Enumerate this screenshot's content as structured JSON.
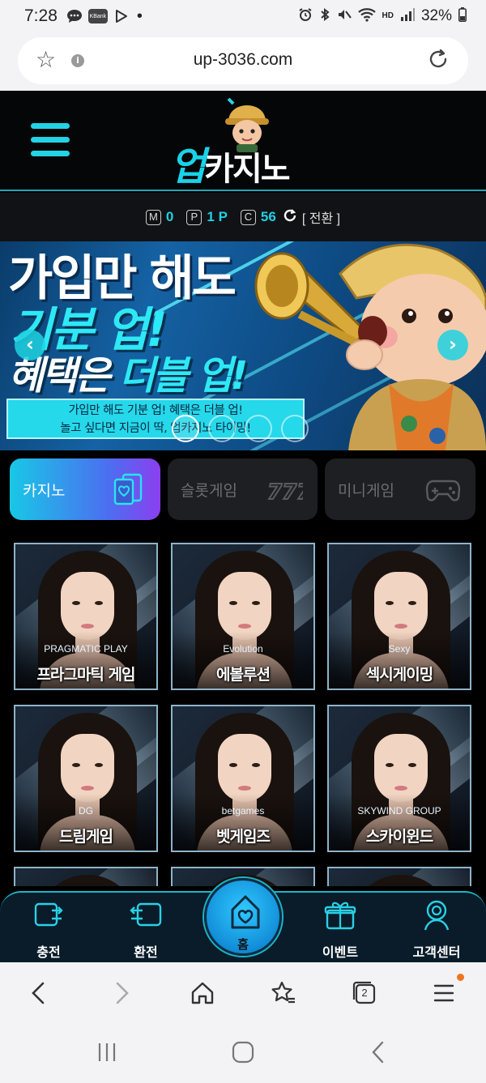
{
  "status_bar": {
    "time": "7:28",
    "ksbank_label": "KBank",
    "battery_percent": "32%",
    "hd_label": "HD"
  },
  "browser": {
    "url": "up-3036.com"
  },
  "site": {
    "logo_up": "업",
    "logo_rest": "카지노"
  },
  "points": {
    "m_badge": "M",
    "m_value": "0",
    "p_badge": "P",
    "p_value": "1 P",
    "c_badge": "C",
    "c_value": "56",
    "switch_label": "[ 전환 ]"
  },
  "banner": {
    "line1": "가입만 해도",
    "line2": "기분 업!",
    "line3_prefix": "혜택은 ",
    "line3_highlight": "더블 업!",
    "box_line1": "가입만 해도 기분 업! 혜택은 더블 업!",
    "box_line2": "놀고 싶다면 지금이 딱, 업카지노 타이밍!",
    "slide_count": 4,
    "active_slide": 1
  },
  "categories": [
    {
      "label": "카지노",
      "active": true,
      "icon": "cards-icon"
    },
    {
      "label": "슬롯게임",
      "active": false,
      "icon": "slot-777-icon"
    },
    {
      "label": "미니게임",
      "active": false,
      "icon": "gamepad-icon"
    }
  ],
  "games": [
    {
      "title": "프라그마틱 게임",
      "brand": "PRAGMATIC PLAY"
    },
    {
      "title": "에볼루션",
      "brand": "Evolution"
    },
    {
      "title": "섹시게이밍",
      "brand": "Sexy"
    },
    {
      "title": "드림게임",
      "brand": "DG"
    },
    {
      "title": "벳게임즈",
      "brand": "betgames"
    },
    {
      "title": "스카이윈드",
      "brand": "SKYWIND GROUP"
    }
  ],
  "site_nav": {
    "charge": "충전",
    "exchange": "환전",
    "home": "홈",
    "event": "이벤트",
    "support": "고객센터"
  },
  "browser_bar": {
    "tab_count": "2"
  },
  "colors": {
    "accent": "#22d3e6",
    "background": "#000000",
    "nav_bg": "#0a1c2a"
  }
}
